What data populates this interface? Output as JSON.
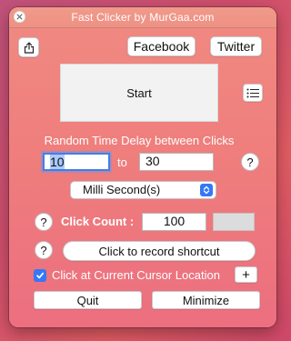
{
  "window": {
    "title": "Fast Clicker by MurGaa.com"
  },
  "header": {
    "share_icon": "share-icon",
    "facebook_label": "Facebook",
    "twitter_label": "Twitter"
  },
  "start": {
    "label": "Start",
    "list_icon": "list-icon"
  },
  "delay": {
    "heading": "Random Time Delay between Clicks",
    "min_value": "10",
    "to_label": "to",
    "max_value": "30",
    "unit_selected": "Milli Second(s)"
  },
  "help": {
    "symbol": "?"
  },
  "click_count": {
    "label": "Click Count :",
    "value": "100"
  },
  "shortcut": {
    "record_label": "Click to record shortcut"
  },
  "cursor": {
    "checked": true,
    "label": "Click at Current Cursor Location",
    "plus_label": "+"
  },
  "footer": {
    "quit_label": "Quit",
    "minimize_label": "Minimize"
  },
  "colors": {
    "accent": "#3478f6",
    "background": "#d04f6c",
    "window": "#ef7e7c"
  }
}
